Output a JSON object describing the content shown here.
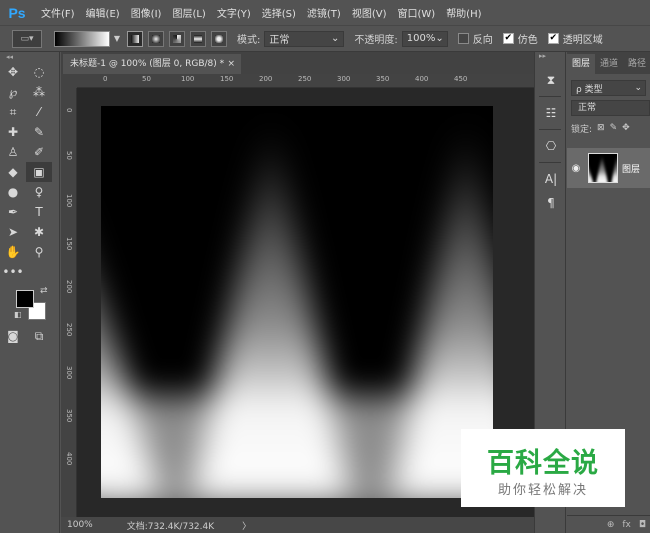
{
  "app": {
    "logo": "Ps"
  },
  "menu": [
    "文件(F)",
    "编辑(E)",
    "图像(I)",
    "图层(L)",
    "文字(Y)",
    "选择(S)",
    "滤镜(T)",
    "视图(V)",
    "窗口(W)",
    "帮助(H)"
  ],
  "options": {
    "mode_label": "模式:",
    "mode_value": "正常",
    "opacity_label": "不透明度:",
    "opacity_value": "100%",
    "reverse_label": "反向",
    "reverse_checked": false,
    "dither_label": "仿色",
    "dither_checked": true,
    "transparency_label": "透明区域",
    "transparency_checked": true
  },
  "document": {
    "tab_title": "未标题-1 @ 100% (图层 0, RGB/8) *",
    "close_glyph": "×",
    "ruler_top_ticks": [
      "0",
      "50",
      "100",
      "150",
      "200",
      "250",
      "300",
      "350",
      "400",
      "450"
    ],
    "ruler_left_ticks": [
      "0",
      "50",
      "100",
      "150",
      "200",
      "250",
      "300",
      "350",
      "400"
    ],
    "zoom": "100%",
    "doc_info": "文档:732.4K/732.4K",
    "status_arrow": "〉"
  },
  "layers_panel": {
    "tabs": [
      "图层",
      "通道",
      "路径"
    ],
    "filter_label": "ρ 类型",
    "blend_mode": "正常",
    "lock_label": "锁定:",
    "layer_name": "图层",
    "footer_icons": [
      "⊕",
      "fx",
      "◘"
    ]
  },
  "watermark": {
    "title": "百科全说",
    "subtitle": "助你轻松解决",
    "title_color": "#2aa944"
  },
  "colors": {
    "foreground": "#000000",
    "background": "#ffffff"
  }
}
